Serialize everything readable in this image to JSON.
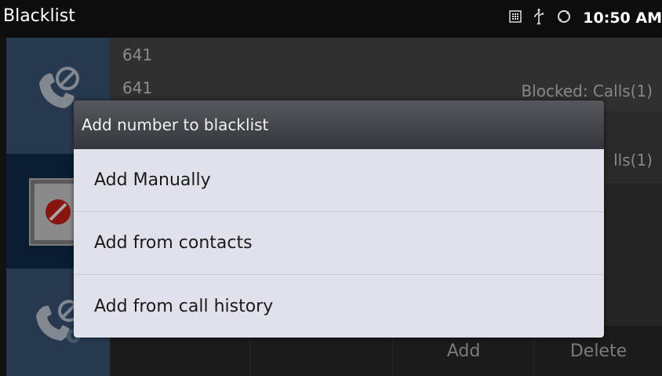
{
  "statusbar": {
    "title": "Blacklist",
    "time": "10:50 AM",
    "icons": [
      "calculator-icon",
      "usb-icon",
      "sync-icon"
    ]
  },
  "list": [
    {
      "number": "641",
      "subnumber": "641",
      "status": "Blocked: Calls(1)"
    },
    {
      "status_partial": "lls(1)"
    }
  ],
  "bottombar": {
    "add_label": "Add",
    "delete_label": "Delete"
  },
  "dialog": {
    "title": "Add number to blacklist",
    "options": [
      "Add Manually",
      "Add from contacts",
      "Add from call history"
    ]
  },
  "colors": {
    "sidebar": "#3c5878",
    "sidebar_selected": "#0f2b4e",
    "dialog_body": "#dfe2ea",
    "blocked_red": "#d0221b"
  }
}
